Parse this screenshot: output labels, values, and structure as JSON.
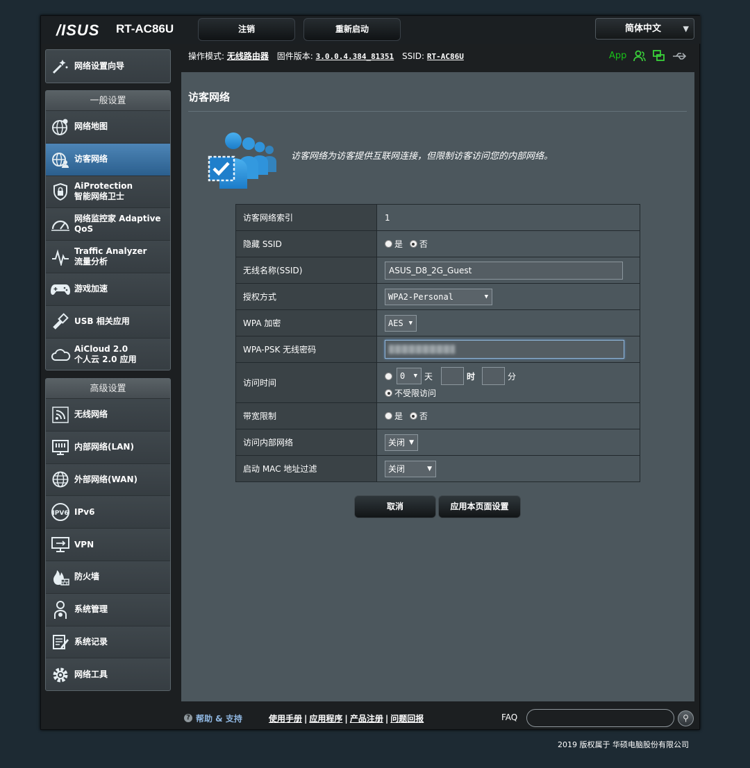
{
  "header": {
    "brand": "/ISUS",
    "model": "RT-AC86U",
    "logout_label": "注销",
    "reboot_label": "重新启动",
    "language": "简体中文"
  },
  "status": {
    "mode_label": "操作模式:",
    "mode_value": "无线路由器",
    "firmware_label": "固件版本:",
    "firmware_value": "3.0.0.4.384_81351",
    "ssid_label": "SSID:",
    "ssid_value": "RT-AC86U",
    "app_label": "App"
  },
  "sidebar": {
    "wizard_label": "网络设置向导",
    "general_title": "一般设置",
    "general_items": [
      {
        "label": "网络地图",
        "icon": "globe-map-icon"
      },
      {
        "label": "访客网络",
        "icon": "guest-globe-icon"
      },
      {
        "label": "AiProtection\n智能网络卫士",
        "icon": "shield-lock-icon"
      },
      {
        "label": "网络监控家 Adaptive\nQoS",
        "icon": "speedometer-icon"
      },
      {
        "label": "Traffic Analyzer\n流量分析",
        "icon": "traffic-analyzer-icon"
      },
      {
        "label": "游戏加速",
        "icon": "gamepad-icon"
      },
      {
        "label": "USB 相关应用",
        "icon": "usb-icon"
      },
      {
        "label": "AiCloud 2.0\n个人云 2.0 应用",
        "icon": "cloud-icon"
      }
    ],
    "advanced_title": "高级设置",
    "advanced_items": [
      {
        "label": "无线网络",
        "icon": "wireless-icon"
      },
      {
        "label": "内部网络(LAN)",
        "icon": "lan-icon"
      },
      {
        "label": "外部网络(WAN)",
        "icon": "wan-globe-icon"
      },
      {
        "label": "IPv6",
        "icon": "ipv6-icon"
      },
      {
        "label": "VPN",
        "icon": "vpn-monitor-icon"
      },
      {
        "label": "防火墙",
        "icon": "firewall-icon"
      },
      {
        "label": "系统管理",
        "icon": "admin-person-icon"
      },
      {
        "label": "系统记录",
        "icon": "log-icon"
      },
      {
        "label": "网络工具",
        "icon": "gear-tools-icon"
      }
    ]
  },
  "page": {
    "title": "访客网络",
    "description": "访客网络为访客提供互联网连接，但限制访客访问您的内部网络。"
  },
  "form": {
    "index_label": "访客网络索引",
    "index_value": "1",
    "hide_ssid_label": "隐藏 SSID",
    "yes": "是",
    "no": "否",
    "ssid_label": "无线名称(SSID)",
    "ssid_value": "ASUS_D8_2G_Guest",
    "auth_label": "授权方式",
    "auth_value": "WPA2-Personal",
    "wpa_enc_label": "WPA 加密",
    "wpa_enc_value": "AES",
    "psk_label": "WPA-PSK 无线密码",
    "access_time_label": "访问时间",
    "days_value": "0",
    "day_unit": "天",
    "hour_unit": "时",
    "minute_unit": "分",
    "unlimited_label": "不受限访问",
    "bandwidth_label": "带宽限制",
    "intranet_label": "访问内部网络",
    "intranet_value": "关闭",
    "mac_filter_label": "启动 MAC 地址过滤",
    "mac_filter_value": "关闭"
  },
  "actions": {
    "cancel_label": "取消",
    "apply_label": "应用本页面设置"
  },
  "footer": {
    "help_label": "帮助 & 支持",
    "links": [
      "使用手册",
      "应用程序",
      "产品注册",
      "问题回报"
    ],
    "faq_label": "FAQ",
    "copyright": "2019 版权属于 华硕电脑股份有限公司"
  },
  "colors": {
    "active_nav": "#3b73a6",
    "app_green": "#19c219",
    "panel_bg": "#4c575d",
    "help_link": "#8fb6e0"
  }
}
